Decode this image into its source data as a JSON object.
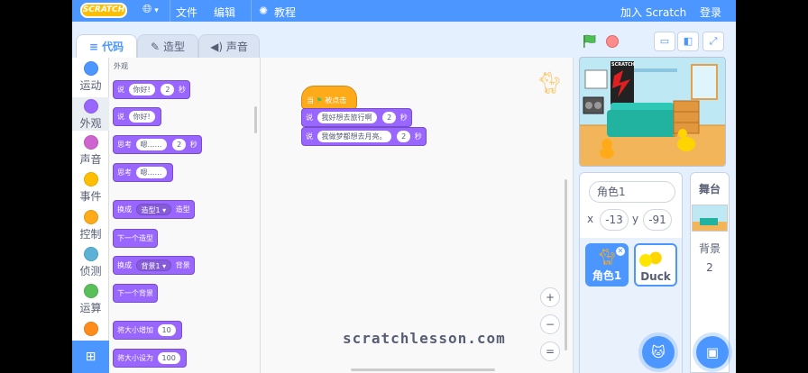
{
  "menu": {
    "logo": "SCRATCH",
    "file": "文件",
    "edit": "编辑",
    "tutorials": "教程",
    "join": "加入 Scratch",
    "login": "登录"
  },
  "tabs": {
    "code": "代码",
    "costumes": "造型",
    "sounds": "声音"
  },
  "categories": [
    {
      "label": "运动",
      "color": "#4c97ff"
    },
    {
      "label": "外观",
      "color": "#9966ff"
    },
    {
      "label": "声音",
      "color": "#cf63cf"
    },
    {
      "label": "事件",
      "color": "#ffbf00"
    },
    {
      "label": "控制",
      "color": "#ffab19"
    },
    {
      "label": "侦测",
      "color": "#5cb1d6"
    },
    {
      "label": "运算",
      "color": "#59c059"
    },
    {
      "label": "",
      "color": "#ff8c1a"
    }
  ],
  "palette": {
    "title": "外观",
    "b1": {
      "a": "说",
      "v1": "你好!",
      "v2": "2",
      "b": "秒"
    },
    "b2": {
      "a": "说",
      "v1": "你好!"
    },
    "b3": {
      "a": "思考",
      "v1": "嗯……",
      "v2": "2",
      "b": "秒"
    },
    "b4": {
      "a": "思考",
      "v1": "嗯……"
    },
    "b5": {
      "a": "换成",
      "v1": "造型1 ▾",
      "b": "造型"
    },
    "b6": {
      "a": "下一个造型"
    },
    "b7": {
      "a": "换成",
      "v1": "背景1 ▾",
      "b": "背景"
    },
    "b8": {
      "a": "下一个背景"
    },
    "b9": {
      "a": "将大小增加",
      "v1": "10"
    },
    "b10": {
      "a": "将大小设为",
      "v1": "100"
    }
  },
  "script": {
    "hat_a": "当",
    "hat_b": "被点击",
    "s1": {
      "a": "说",
      "v1": "我好想去旅行啊",
      "v2": "2",
      "b": "秒"
    },
    "s2": {
      "a": "说",
      "v1": "我做梦都想去月亮。",
      "v2": "2",
      "b": "秒"
    }
  },
  "watermark": "scratchlesson.com",
  "zoom": {
    "in": "+",
    "out": "−",
    "reset": "="
  },
  "sprite_info": {
    "name": "角色1",
    "x_label": "x",
    "x": "-13",
    "y_label": "y",
    "y": "-91"
  },
  "sprites": [
    "角色1",
    "Duck"
  ],
  "stage_pane": {
    "title": "舞台",
    "backdrops_label": "背景",
    "backdrops_count": "2"
  },
  "stage_sign": "SCRATCH",
  "icons": {
    "globe": "globe-icon",
    "bulb": "bulb-icon",
    "green_flag": "green-flag-icon",
    "stop": "stop-icon",
    "add_sprite": "add-sprite-icon",
    "add_backdrop": "add-backdrop-icon",
    "extension": "extension-icon"
  },
  "colors": {
    "menu": "#4c97ff",
    "looks": "#9966ff",
    "events": "#ffab19"
  }
}
